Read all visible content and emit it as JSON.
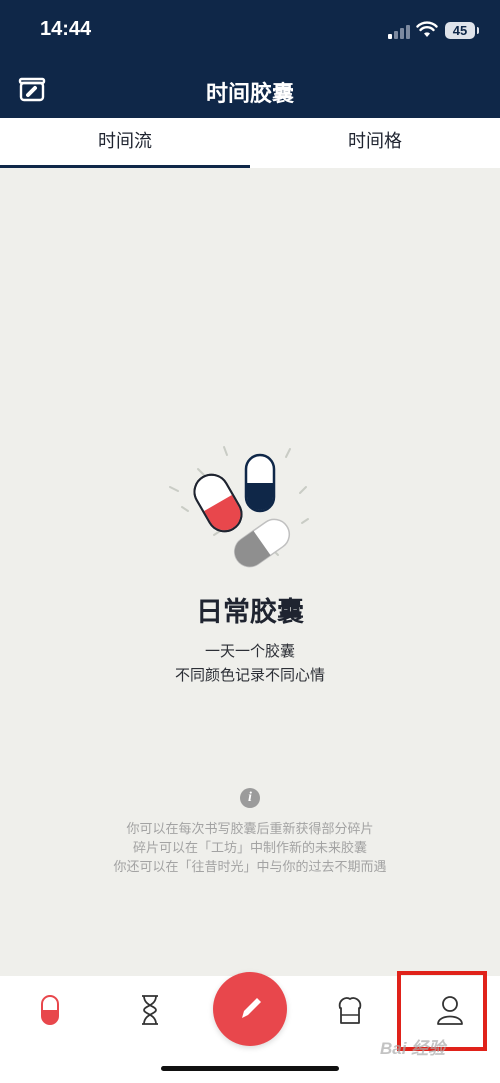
{
  "status_bar": {
    "time": "14:44",
    "battery": "45"
  },
  "nav": {
    "title": "时间胶囊",
    "left_icon": "capsule-box-icon"
  },
  "tabs": [
    {
      "label": "时间流",
      "active": true
    },
    {
      "label": "时间格",
      "active": false
    }
  ],
  "empty_state": {
    "title": "日常胶囊",
    "lines": [
      "一天一个胶囊",
      "不同颜色记录不同心情"
    ]
  },
  "hints": [
    "你可以在每次书写胶囊后重新获得部分碎片",
    "碎片可以在「工坊」中制作新的未来胶囊",
    "你还可以在「往昔时光」中与你的过去不期而遇"
  ],
  "tabbar": {
    "items": [
      "capsule-icon",
      "hourglass-icon",
      "pencil-icon",
      "workshop-icon",
      "user-icon"
    ]
  },
  "watermark": "Bai 经验",
  "colors": {
    "navy": "#0f2748",
    "accent_red": "#e8474c",
    "background": "#efefeb",
    "highlight": "#e0221a"
  }
}
